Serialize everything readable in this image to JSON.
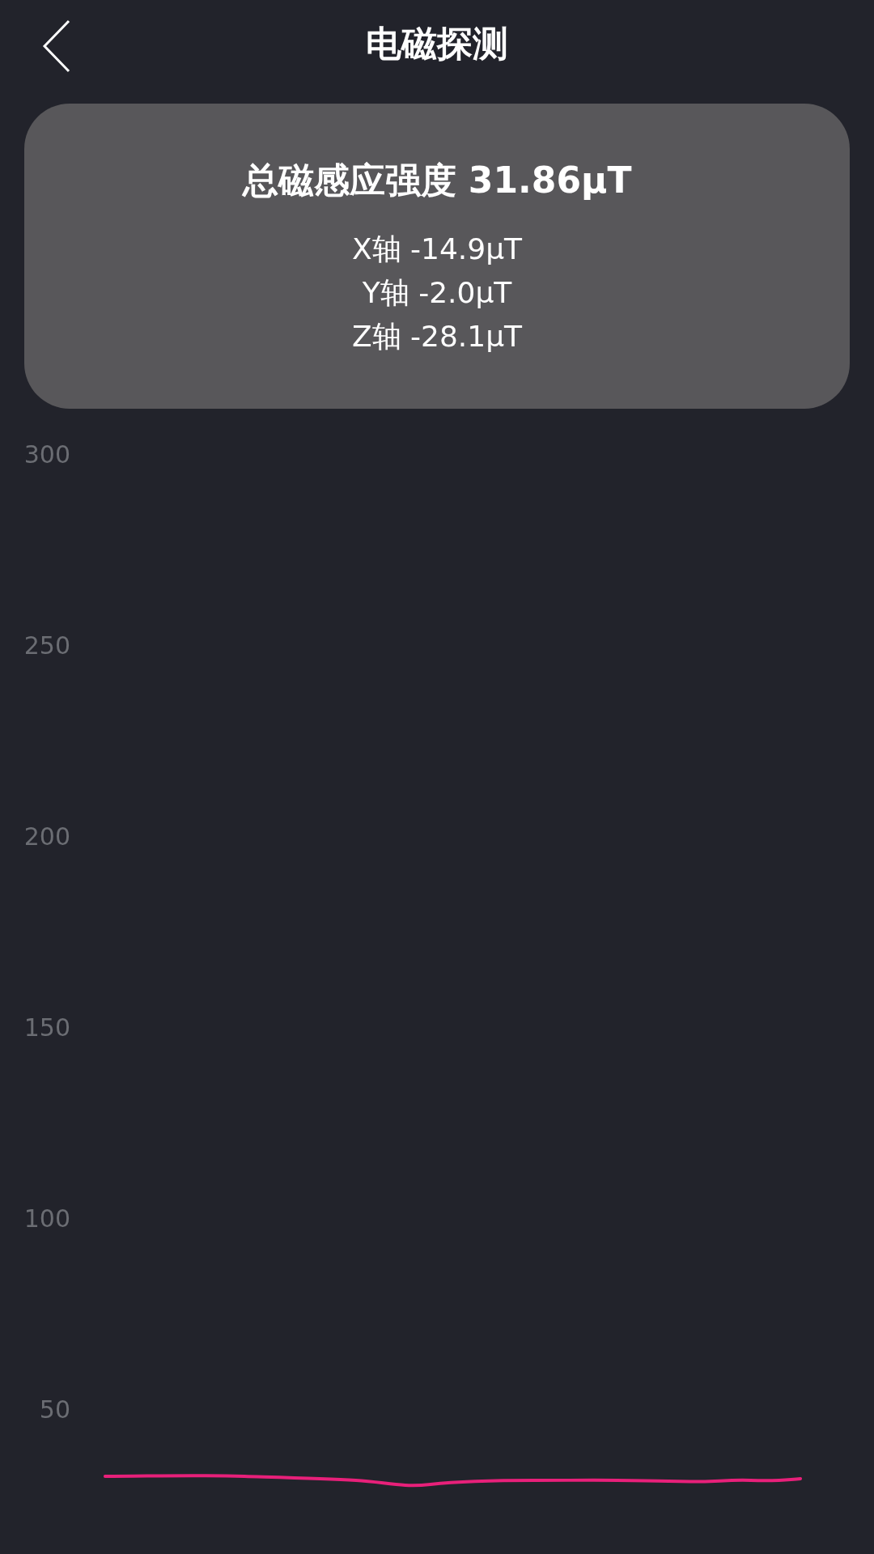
{
  "header": {
    "title": "电磁探测"
  },
  "summary": {
    "total_label": "总磁感应强度",
    "total_value": "31.86μT",
    "axes": [
      {
        "label": "X轴",
        "value": "-14.9μT"
      },
      {
        "label": "Y轴",
        "value": "-2.0μT"
      },
      {
        "label": "Z轴",
        "value": "-28.1μT"
      }
    ]
  },
  "chart": {
    "y_labels": [
      "300",
      "250",
      "200",
      "150",
      "100",
      "50"
    ]
  }
}
